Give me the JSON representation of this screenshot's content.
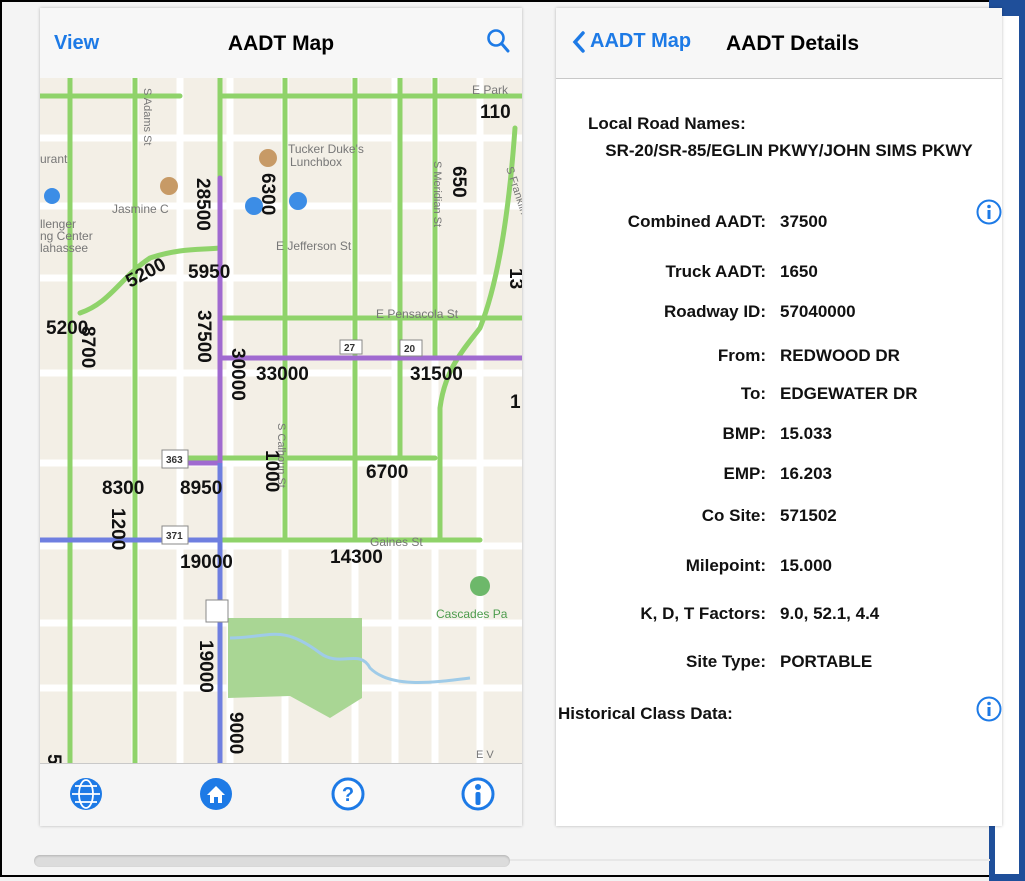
{
  "left_screen": {
    "nav": {
      "left_button": "View",
      "title": "AADT Map",
      "right_icon": "search-icon"
    },
    "map": {
      "street_labels": [
        "S Adams St",
        "Tucker Duke's",
        "Lunchbox",
        "Jasmine C",
        "llenger",
        "ng Center",
        "lahassee",
        "E Jefferson St",
        "S Meridian St",
        "E Pensacola St",
        "S Franklin Blvd",
        "S Calhoun St",
        "Gaines St",
        "Cascades Pa",
        "E Park",
        "S"
      ],
      "shield_labels": [
        "27",
        "20",
        "363",
        "371"
      ],
      "aadt_counts": [
        "110",
        "6300",
        "28500",
        "650",
        "5200",
        "5950",
        "5200",
        "8700",
        "37500",
        "30000",
        "33000",
        "31500",
        "6700",
        "8300",
        "8950",
        "1000",
        "1200",
        "19000",
        "14300",
        "19000",
        "9000",
        "1",
        "13"
      ],
      "partial_labels": [
        "urant",
        "E V",
        "5"
      ]
    },
    "tabbar": [
      "globe-icon",
      "home-icon",
      "help-icon",
      "info-pin-icon"
    ]
  },
  "right_screen": {
    "nav": {
      "back_label": "AADT Map",
      "title": "AADT Details"
    },
    "local_road_names_label": "Local Road Names:",
    "local_road_names_value": "SR-20/SR-85/EGLIN PKWY/JOHN SIMS PKWY",
    "fields": [
      {
        "label": "Combined AADT:",
        "value": "37500"
      },
      {
        "label": "Truck AADT:",
        "value": "1650"
      },
      {
        "label": "Roadway ID:",
        "value": "57040000"
      },
      {
        "label": "From:",
        "value": "REDWOOD DR"
      },
      {
        "label": "To:",
        "value": "EDGEWATER DR"
      },
      {
        "label": "BMP:",
        "value": "15.033"
      },
      {
        "label": "EMP:",
        "value": "16.203"
      },
      {
        "label": "Co Site:",
        "value": "571502"
      },
      {
        "label": "Milepoint:",
        "value": "15.000"
      },
      {
        "label": "K, D, T Factors:",
        "value": "9.0, 52.1, 4.4"
      },
      {
        "label": "Site Type:",
        "value": "PORTABLE"
      }
    ],
    "historical_label": "Historical Class Data:"
  },
  "colors": {
    "accent": "#1d7ae6",
    "road_green": "#8fd36a",
    "road_purple": "#a06ad0",
    "road_blue": "#6f7fe0",
    "park": "#a9d694",
    "frame_blue": "#1f4f9a"
  }
}
